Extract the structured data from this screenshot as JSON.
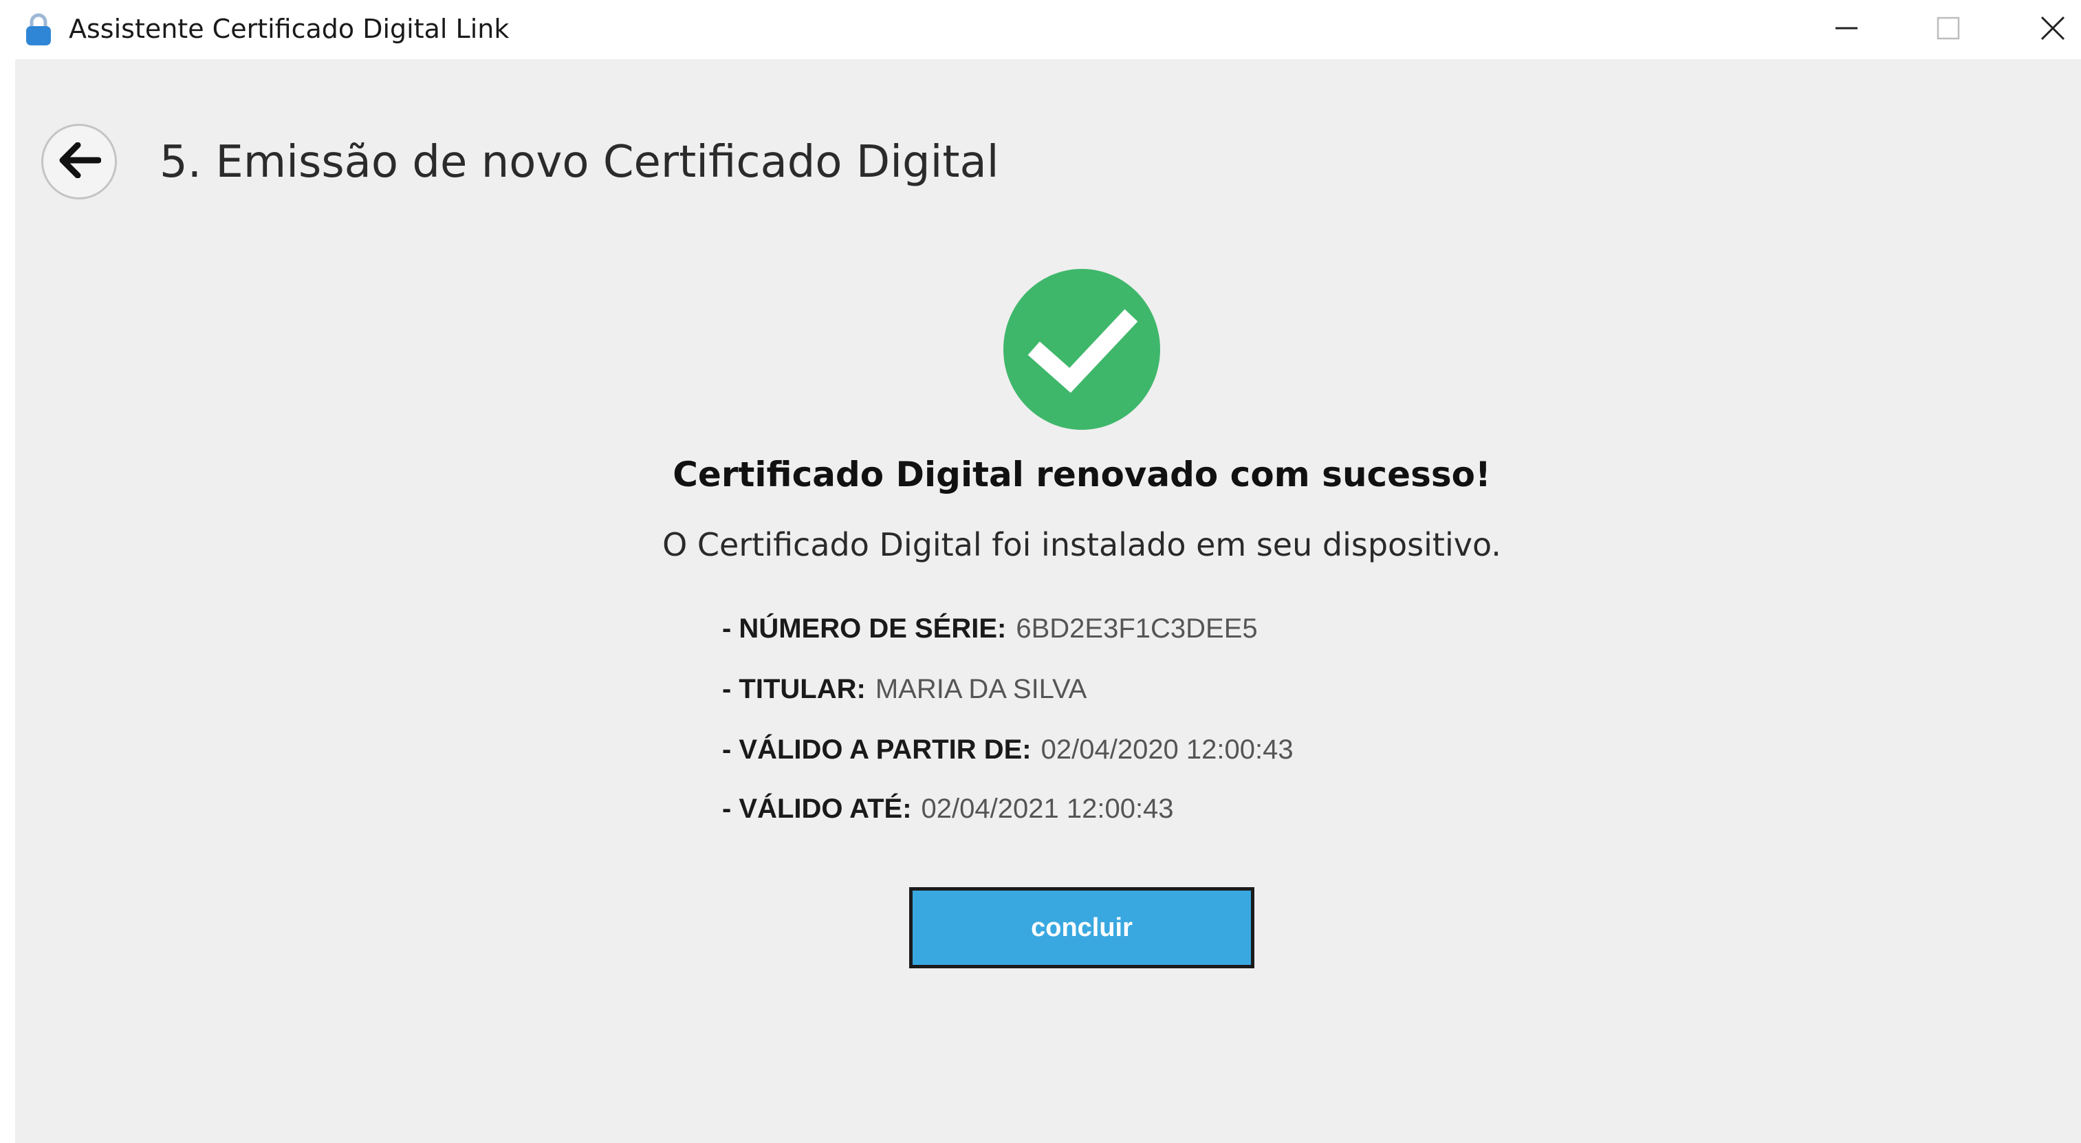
{
  "window": {
    "title": "Assistente Certificado Digital Link",
    "controls": {
      "minimize_icon": "minimize-icon",
      "maximize_icon": "maximize-icon",
      "close_icon": "close-icon"
    },
    "app_icon": "lock-icon"
  },
  "header": {
    "back_icon": "arrow-left-icon",
    "title": "5. Emissão de novo Certificado Digital"
  },
  "result": {
    "status_icon": "check-circle-icon",
    "status_color": "#3fb76b",
    "heading": "Certificado Digital renovado com sucesso!",
    "message": "O Certificado Digital foi instalado em seu dispositivo."
  },
  "details": [
    {
      "label": "- NÚMERO DE SÉRIE:",
      "value": "6BD2E3F1C3DEE5"
    },
    {
      "label": "- TITULAR:",
      "value": "MARIA DA SILVA"
    },
    {
      "label": "- VÁLIDO A PARTIR DE:",
      "value": "02/04/2020 12:00:43"
    },
    {
      "label": "- VÁLIDO ATÉ:",
      "value": "02/04/2021 12:00:43"
    }
  ],
  "actions": {
    "conclude_label": "concluir",
    "conclude_color": "#3aa8e0"
  }
}
